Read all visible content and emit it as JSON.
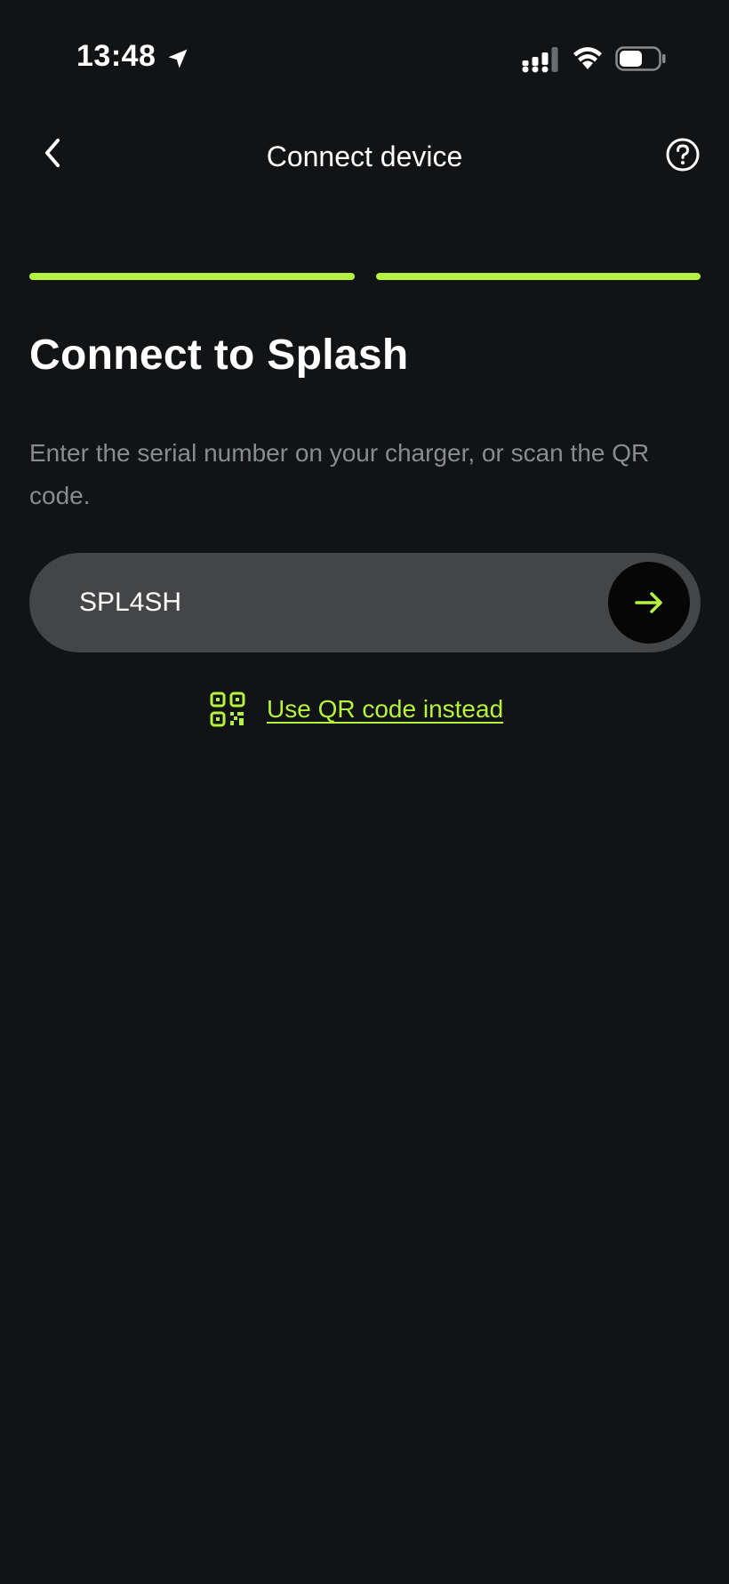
{
  "status_bar": {
    "time": "13:48",
    "icons": [
      "location-arrow-icon",
      "cellular-signal-icon",
      "wifi-icon",
      "battery-icon"
    ]
  },
  "header": {
    "title": "Connect device",
    "back_icon": "chevron-left-icon",
    "help_icon": "help-circle-icon"
  },
  "progress": {
    "total_steps": 2,
    "completed_steps": 2,
    "color": "#b5f33f"
  },
  "main": {
    "heading": "Connect to Splash",
    "description": "Enter the serial number on your charger, or scan the QR code.",
    "serial_input": {
      "value": "SPL4SH"
    },
    "submit_icon": "arrow-right-icon",
    "qr_link": {
      "label": "Use QR code instead",
      "icon": "qr-code-icon"
    }
  },
  "colors": {
    "background": "#121315",
    "accent": "#b5f33f",
    "input_background": "#444547",
    "muted_text": "#8a8b8d"
  }
}
